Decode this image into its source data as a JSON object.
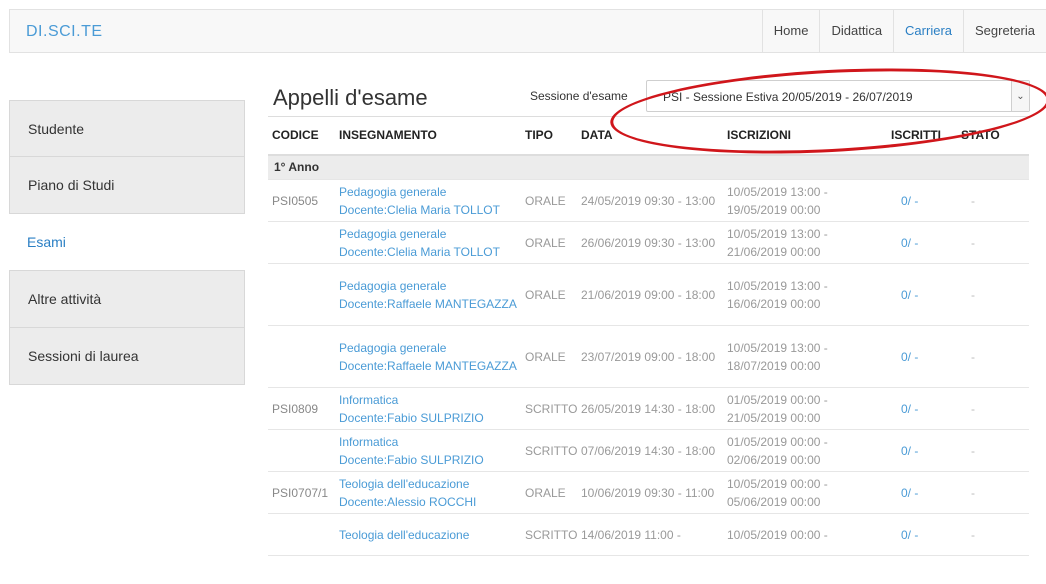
{
  "navbar": {
    "brand": "DI.SCI.TE",
    "links": [
      {
        "label": "Home",
        "active": false
      },
      {
        "label": "Didattica",
        "active": false
      },
      {
        "label": "Carriera",
        "active": true
      },
      {
        "label": "Segreteria",
        "active": false
      }
    ]
  },
  "sidebar": {
    "items": [
      {
        "label": "Studente"
      },
      {
        "label": "Piano di Studi"
      },
      {
        "label": "Esami"
      },
      {
        "label": "Altre attività"
      },
      {
        "label": "Sessioni di laurea"
      }
    ]
  },
  "main": {
    "title": "Appelli d'esame",
    "session_label": "Sessione d'esame",
    "session_value": "PSI - Sessione Estiva 20/05/2019 - 26/07/2019"
  },
  "table": {
    "headers": {
      "codice": "CODICE",
      "insegnamento": "INSEGNAMENTO",
      "tipo": "TIPO",
      "data": "DATA",
      "iscrizioni": "ISCRIZIONI",
      "iscritti": "ISCRITTI",
      "stato": "STATO"
    },
    "group": "1° Anno",
    "rows": [
      {
        "codice": "PSI0505",
        "corso": "Pedagogia generale",
        "docente": "Docente:Clelia Maria TOLLOT",
        "tipo": "ORALE",
        "data": "24/05/2019 09:30 - 13:00",
        "iscrizioni": "10/05/2019 13:00 - 19/05/2019 00:00",
        "iscritti": "0/ -",
        "stato": "-"
      },
      {
        "codice": "",
        "corso": "Pedagogia generale",
        "docente": "Docente:Clelia Maria TOLLOT",
        "tipo": "ORALE",
        "data": "26/06/2019 09:30 - 13:00",
        "iscrizioni": "10/05/2019 13:00 - 21/06/2019 00:00",
        "iscritti": "0/ -",
        "stato": "-"
      },
      {
        "codice": "",
        "corso": "Pedagogia generale",
        "docente": "Docente:Raffaele MANTEGAZZA",
        "tipo": "ORALE",
        "data": "21/06/2019 09:00 - 18:00",
        "iscrizioni": "10/05/2019 13:00 - 16/06/2019 00:00",
        "iscritti": "0/ -",
        "stato": "-"
      },
      {
        "codice": "",
        "corso": "Pedagogia generale",
        "docente": "Docente:Raffaele MANTEGAZZA",
        "tipo": "ORALE",
        "data": "23/07/2019 09:00 - 18:00",
        "iscrizioni": "10/05/2019 13:00 - 18/07/2019 00:00",
        "iscritti": "0/ -",
        "stato": "-"
      },
      {
        "codice": "PSI0809",
        "corso": "Informatica",
        "docente": "Docente:Fabio SULPRIZIO",
        "tipo": "SCRITTO",
        "data": "26/05/2019 14:30 - 18:00",
        "iscrizioni": "01/05/2019 00:00 - 21/05/2019 00:00",
        "iscritti": "0/ -",
        "stato": "-"
      },
      {
        "codice": "",
        "corso": "Informatica",
        "docente": "Docente:Fabio SULPRIZIO",
        "tipo": "SCRITTO",
        "data": "07/06/2019 14:30 - 18:00",
        "iscrizioni": "01/05/2019 00:00 - 02/06/2019 00:00",
        "iscritti": "0/ -",
        "stato": "-"
      },
      {
        "codice": "PSI0707/1",
        "corso": "Teologia dell'educazione",
        "docente": "Docente:Alessio ROCCHI",
        "tipo": "ORALE",
        "data": "10/06/2019 09:30 - 11:00",
        "iscrizioni": "10/05/2019 00:00 - 05/06/2019 00:00",
        "iscritti": "0/ -",
        "stato": "-"
      },
      {
        "codice": "",
        "corso": "Teologia dell'educazione",
        "docente": "",
        "tipo": "SCRITTO",
        "data": "14/06/2019 11:00 -",
        "iscrizioni": "10/05/2019 00:00 -",
        "iscritti": "0/ -",
        "stato": "-"
      }
    ]
  }
}
